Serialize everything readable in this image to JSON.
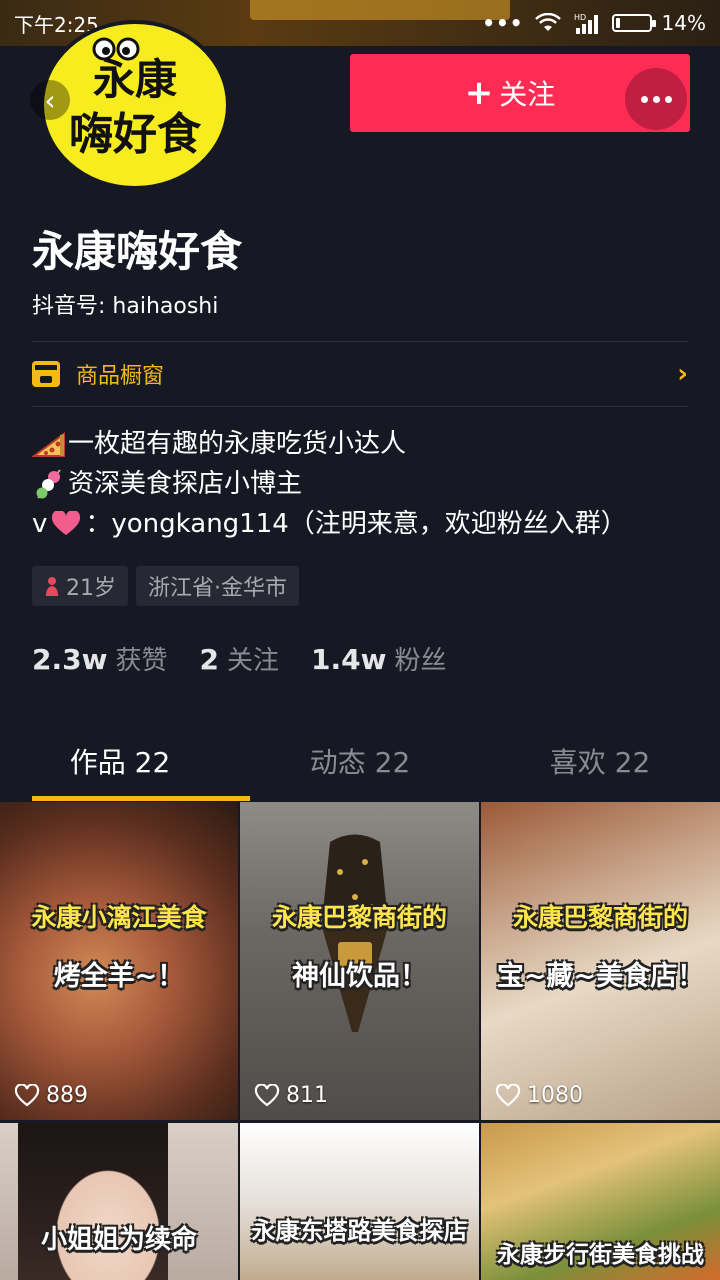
{
  "status_bar": {
    "time": "下午2:25",
    "dots": "•••",
    "network": "HD",
    "battery": "14%",
    "battery_level": 0.14
  },
  "header": {
    "avatar_line1": "永康",
    "avatar_line2": "嗨好食",
    "back_icon": "back-arrow-icon",
    "follow_label": "关注",
    "follow_plus": "+",
    "accent_color": "#fe2c55"
  },
  "profile": {
    "name": "永康嗨好食",
    "id_label": "抖音号: ",
    "id_value": "haihaoshi",
    "shop_label": "商品橱窗",
    "shop_chevron": "›",
    "bio_line1": "一枚超有趣的永康吃货小达人",
    "bio_line2": "资深美食探店小博主",
    "bio_line3_prefix": "v",
    "bio_line3_text": "：yongkang114（注明来意，欢迎粉丝入群）",
    "tags": {
      "age": "21岁",
      "location": "浙江省·金华市"
    },
    "stats": {
      "likes_num": "2.3w",
      "likes_label": "获赞",
      "following_num": "2",
      "following_label": "关注",
      "fans_num": "1.4w",
      "fans_label": "粉丝"
    },
    "highlight_color": "#f4b914"
  },
  "tabs": [
    {
      "label": "作品 22",
      "active": true
    },
    {
      "label": "动态 22",
      "active": false
    },
    {
      "label": "喜欢 22",
      "active": false
    }
  ],
  "videos": [
    {
      "caption1": "永康小漓江美食",
      "caption2": "烤全羊~！",
      "likes": "889"
    },
    {
      "caption1": "永康巴黎商街的",
      "caption2": "神仙饮品！",
      "likes": "811"
    },
    {
      "caption1": "永康巴黎商街的",
      "caption2": "宝~藏~美食店！",
      "likes": "1080"
    },
    {
      "caption1": "小姐姐为续命",
      "caption2": "",
      "likes": ""
    },
    {
      "caption1": "永康东塔路美食探店",
      "caption2": "",
      "likes": ""
    },
    {
      "caption1": "永康步行街美食挑战",
      "caption2": "",
      "likes": ""
    }
  ]
}
